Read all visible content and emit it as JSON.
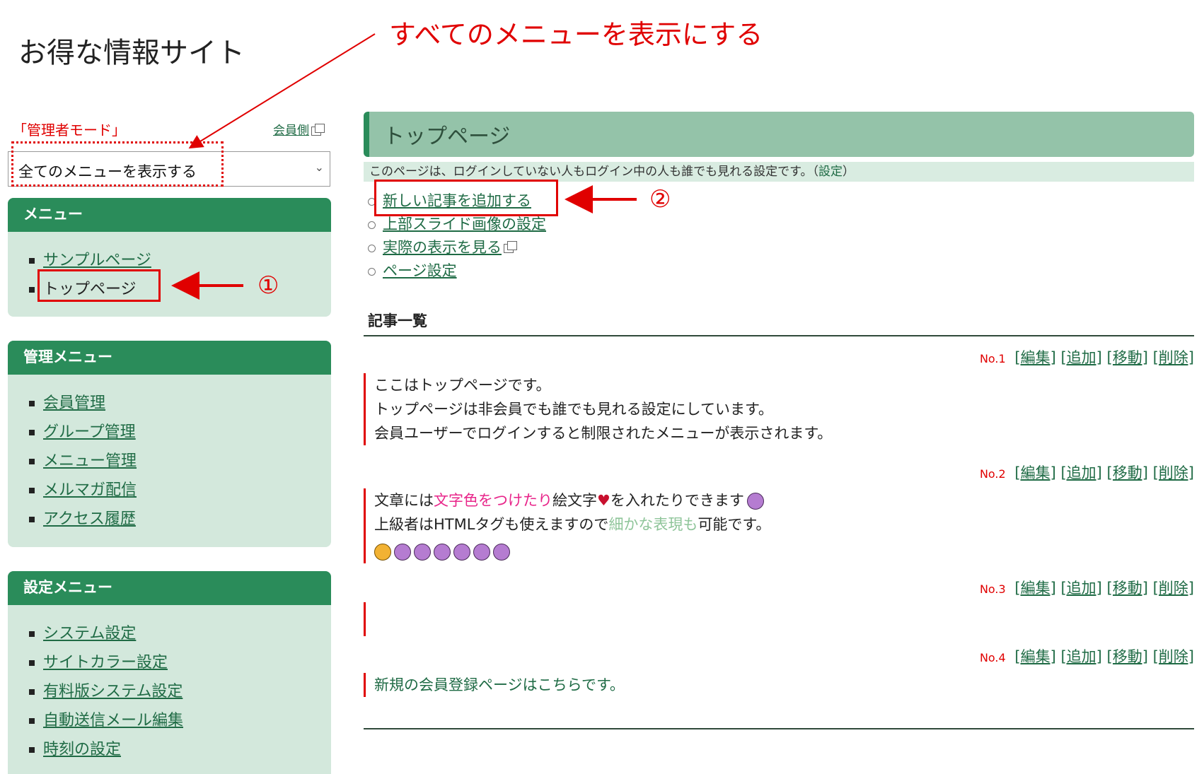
{
  "site_title": "お得な情報サイト",
  "admin_mode_label": "「管理者モード」",
  "member_side_link": "会員側",
  "mode_select": {
    "value": "全てのメニューを表示する"
  },
  "menu_panel": {
    "title": "メニュー",
    "items": [
      {
        "label": "サンプルページ"
      },
      {
        "label": "トップページ"
      }
    ]
  },
  "admin_panel": {
    "title": "管理メニュー",
    "items": [
      {
        "label": "会員管理"
      },
      {
        "label": "グループ管理"
      },
      {
        "label": "メニュー管理"
      },
      {
        "label": "メルマガ配信"
      },
      {
        "label": "アクセス履歴"
      }
    ]
  },
  "settings_panel": {
    "title": "設定メニュー",
    "items": [
      {
        "label": "システム設定"
      },
      {
        "label": "サイトカラー設定"
      },
      {
        "label": "有料版システム設定"
      },
      {
        "label": "自動送信メール編集"
      },
      {
        "label": "時刻の設定"
      }
    ]
  },
  "page": {
    "title": "トップページ",
    "note_text": "このページは、ログインしていない人もログイン中の人も誰でも見れる設定です。",
    "note_open": "（",
    "note_link": "設定",
    "note_close": "）",
    "actions": [
      "新しい記事を追加する",
      "上部スライド画像の設定",
      "実際の表示を見る",
      "ページ設定"
    ],
    "article_list_title": "記事一覧",
    "row_controls": {
      "edit": "[編集]",
      "add": "[追加]",
      "move": "[移動]",
      "delete": "[削除]"
    },
    "articles": [
      {
        "no": "No.1",
        "lines": [
          "ここはトップページです。",
          "トップページは非会員でも誰でも見れる設定にしています。",
          "会員ユーザーでログインすると制限されたメニューが表示されます。"
        ]
      },
      {
        "no": "No.2",
        "line1_a": "文章には",
        "line1_pink": "文字色をつけたり",
        "line1_b": "絵文字",
        "line1_c": "を入れたりできます",
        "line2_a": "上級者はHTMLタグも使えますので",
        "line2_green": "細かな表現も",
        "line2_b": "可能です。"
      },
      {
        "no": "No.3"
      },
      {
        "no": "No.4",
        "link": "新規の会員登録ページはこちらです。"
      }
    ]
  },
  "annotations": {
    "top": "すべてのメニューを表示にする",
    "n1": "①",
    "n2": "②"
  },
  "colors": {
    "brand_green": "#2a8c5a",
    "panel_bg": "#d3e8dc",
    "header_bg": "#94c3a9",
    "annotation_red": "#e00000",
    "pink": "#e8258a"
  }
}
